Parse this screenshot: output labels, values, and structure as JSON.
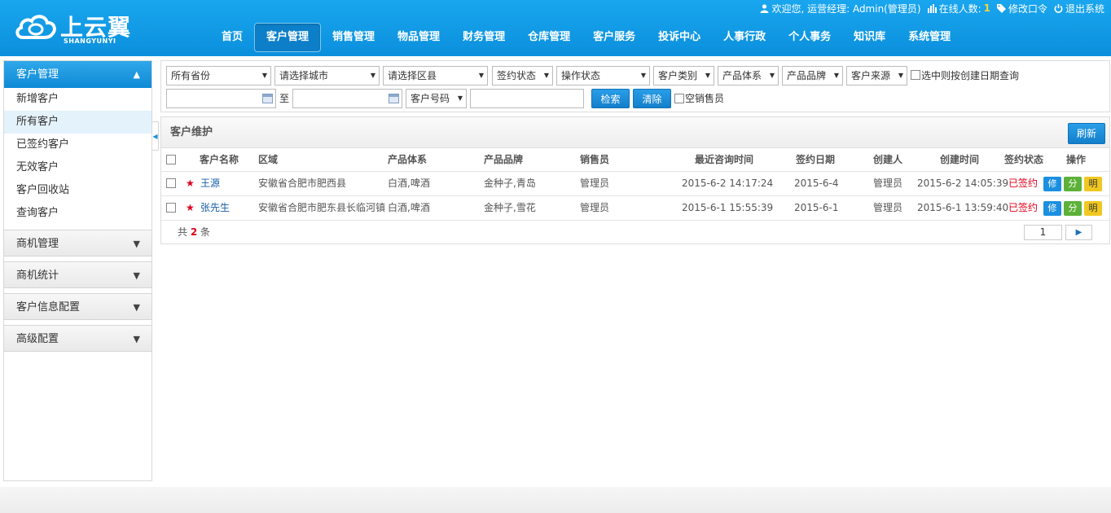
{
  "brand": {
    "name": "上云翼",
    "sub": "SHANGYUNYI"
  },
  "topbar": {
    "welcome": "欢迎您, 运营经理: Admin(管理员)",
    "online_label": "在线人数:",
    "online_count": "1",
    "change_password": "修改口令",
    "logout": "退出系统"
  },
  "nav": [
    "首页",
    "客户管理",
    "销售管理",
    "物品管理",
    "财务管理",
    "仓库管理",
    "客户服务",
    "投诉中心",
    "人事行政",
    "个人事务",
    "知识库",
    "系统管理"
  ],
  "sidebar": {
    "head": "客户管理",
    "items": [
      "新增客户",
      "所有客户",
      "已签约客户",
      "无效客户",
      "客户回收站",
      "查询客户"
    ],
    "groups": [
      "商机管理",
      "商机统计",
      "客户信息配置",
      "高级配置"
    ]
  },
  "filters": {
    "province": "所有省份",
    "city": "请选择城市",
    "district": "请选择区县",
    "sign_status": "签约状态",
    "op_status": "操作状态",
    "customer_type": "客户类别",
    "product_system": "产品体系",
    "product_brand": "产品品牌",
    "customer_source": "客户来源",
    "date_check_label": "选中则按创建日期查询",
    "to_label": "至",
    "number_type": "客户号码",
    "search_btn": "检索",
    "clear_btn": "清除",
    "empty_sales_label": "空销售员"
  },
  "panel": {
    "title": "客户维护",
    "refresh": "刷新",
    "columns": [
      "客户名称",
      "区域",
      "产品体系",
      "产品品牌",
      "销售员",
      "最近咨询时间",
      "签约日期",
      "创建人",
      "创建时间",
      "签约状态",
      "操作"
    ],
    "rows": [
      {
        "name": "王源",
        "area": "安徽省合肥市肥西县",
        "system": "白酒,啤酒",
        "brand": "金种子,青岛",
        "sales": "管理员",
        "last_consult": "2015-6-2 14:17:24",
        "sign_date": "2015-6-4",
        "creator": "管理员",
        "created": "2015-6-2 14:05:39",
        "status": "已签约"
      },
      {
        "name": "张先生",
        "area": "安徽省合肥市肥东县长临河镇",
        "system": "白酒,啤酒",
        "brand": "金种子,雪花",
        "sales": "管理员",
        "last_consult": "2015-6-1 15:55:39",
        "sign_date": "2015-6-1",
        "creator": "管理员",
        "created": "2015-6-1 13:59:40",
        "status": "已签约"
      }
    ],
    "ops": {
      "edit": "修",
      "share": "分",
      "detail": "明"
    },
    "total_prefix": "共",
    "total_count": "2",
    "total_suffix": "条",
    "page": "1"
  },
  "colors": {
    "header": "#0f9be6",
    "accent": "#1a8fd8",
    "danger": "#e0001b"
  }
}
